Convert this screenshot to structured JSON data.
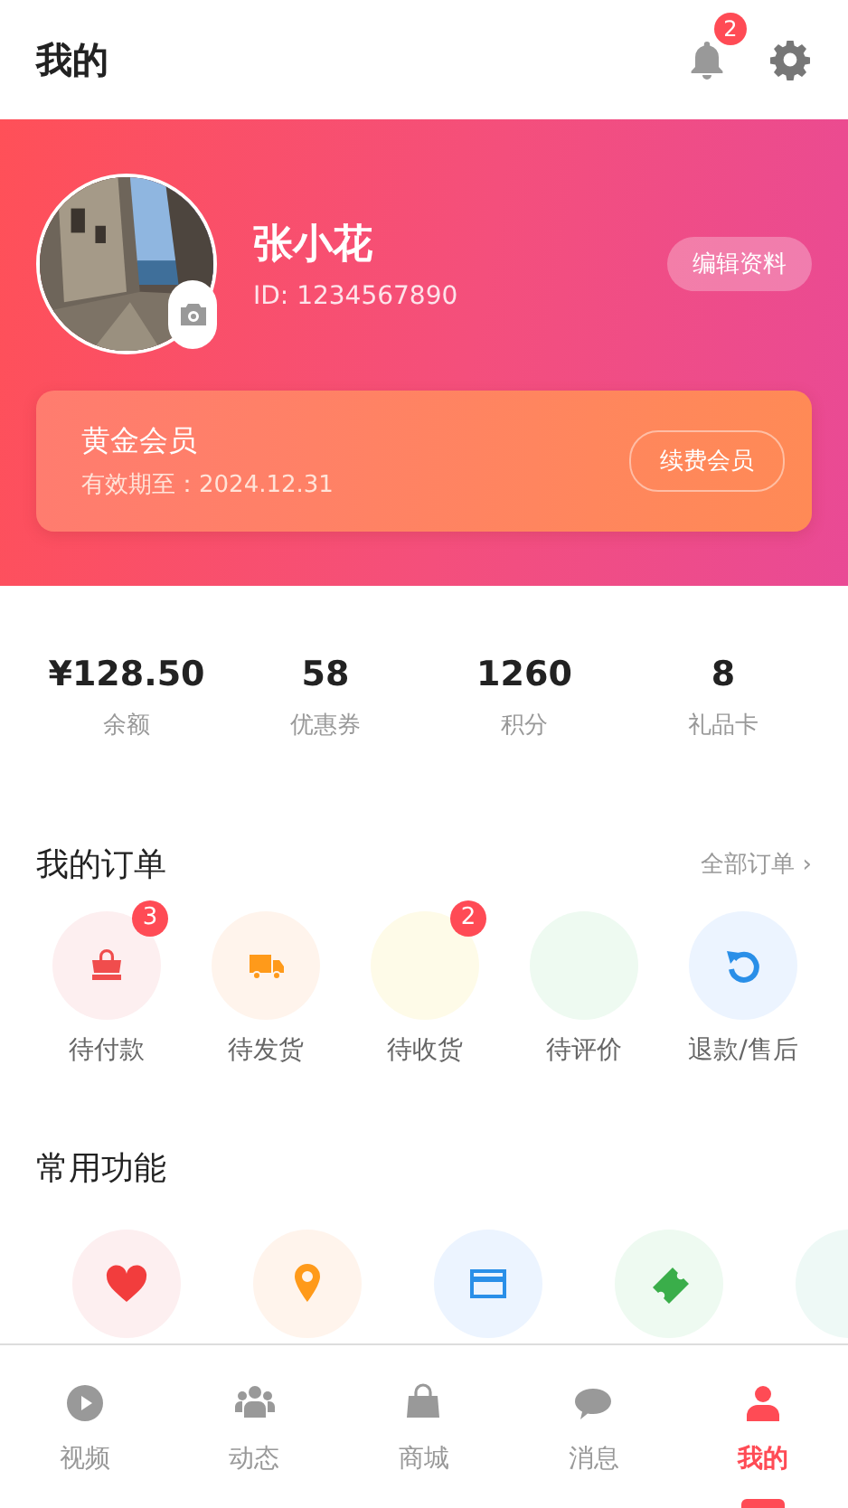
{
  "header": {
    "title": "我的",
    "notifications": "2"
  },
  "profile": {
    "name": "张小花",
    "id": "ID: 1234567890",
    "edit": "编辑资料"
  },
  "membership": {
    "level": "黄金会员",
    "expiry": "有效期至：2024.12.31",
    "renew": "续费会员"
  },
  "stats": [
    {
      "value": "¥128.50",
      "label": "余额"
    },
    {
      "value": "58",
      "label": "优惠券"
    },
    {
      "value": "1260",
      "label": "积分"
    },
    {
      "value": "8",
      "label": "礼品卡"
    }
  ],
  "orders": {
    "title": "我的订单",
    "more": "全部订单 ›",
    "items": [
      {
        "label": "待付款",
        "badge": "3",
        "color": "#fdeff0"
      },
      {
        "label": "待发货",
        "color": "#fff4ec"
      },
      {
        "label": "待收货",
        "badge": "2",
        "color": "#fefbe8"
      },
      {
        "label": "待评价",
        "color": "#eefaf1"
      },
      {
        "label": "退款/售后",
        "color": "#ecf4ff"
      }
    ]
  },
  "features": {
    "title": "常用功能",
    "items": [
      {
        "color": "#fdeff0"
      },
      {
        "color": "#fff4ec"
      },
      {
        "color": "#ecf4ff"
      },
      {
        "color": "#eefaf1"
      },
      {
        "color": "#eef9f6"
      }
    ]
  },
  "tabs": [
    {
      "label": "视频",
      "selected": false
    },
    {
      "label": "动态",
      "selected": false
    },
    {
      "label": "商城",
      "selected": false
    },
    {
      "label": "消息",
      "selected": false
    },
    {
      "label": "我的",
      "selected": true
    }
  ]
}
